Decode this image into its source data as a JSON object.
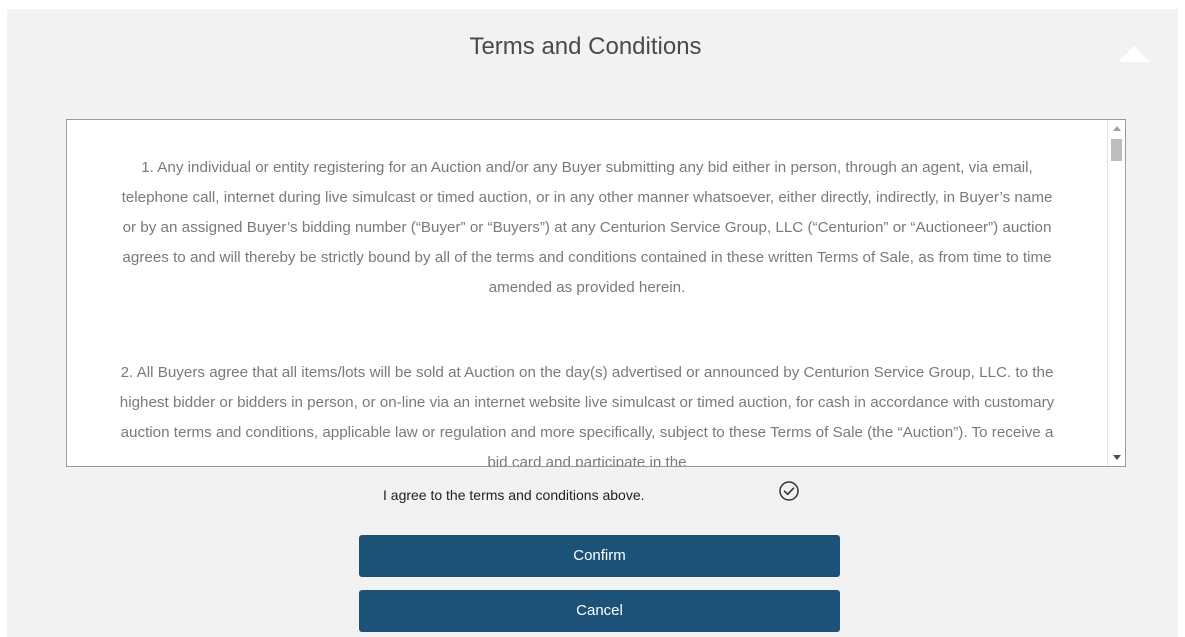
{
  "dialog": {
    "title": "Terms and Conditions",
    "collapse_icon": "caret-up-icon"
  },
  "terms": {
    "paragraphs": [
      "1. Any individual or entity registering for an Auction and/or any Buyer submitting any bid either in person, through an agent, via email, telephone call, internet during live simulcast or timed auction, or in any other manner whatsoever, either directly, indirectly, in Buyer’s name or by an assigned Buyer’s bidding number (“Buyer” or “Buyers”) at any Centurion Service Group, LLC (“Centurion” or “Auctioneer”) auction agrees to and will thereby be strictly bound by all of the terms and conditions contained in these written Terms of Sale, as from time to time amended as provided herein.",
      "2. All Buyers agree that all items/lots will be sold at Auction on the day(s) advertised or announced by Centurion Service Group, LLC. to the highest bidder or bidders in person, or on-line via an internet website live simulcast or timed auction, for cash in accordance with customary auction terms and conditions, applicable law or regulation and more specifically, subject to these Terms of Sale (the “Auction”). To receive a bid card and participate in the"
    ]
  },
  "agreement": {
    "label": "I agree to the terms and conditions above.",
    "icon": "check-circle-icon",
    "checked": true
  },
  "buttons": {
    "confirm_label": "Confirm",
    "cancel_label": "Cancel"
  },
  "colors": {
    "button_bg": "#1d5278",
    "panel_bg": "#f2f2f2",
    "terms_text": "#7a7a7a"
  }
}
